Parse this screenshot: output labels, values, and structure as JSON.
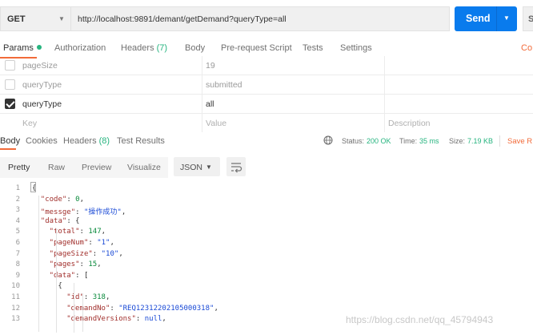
{
  "request": {
    "method": "GET",
    "url": "http://localhost:9891/demant/getDemand?queryType=all",
    "send_label": "Send",
    "save_label_partial": "S"
  },
  "request_tabs": {
    "params": "Params",
    "authorization": "Authorization",
    "headers": "Headers",
    "headers_count": "(7)",
    "body": "Body",
    "prerequest": "Pre-request Script",
    "tests": "Tests",
    "settings": "Settings",
    "cookies_partial": "Co"
  },
  "params": {
    "rows": [
      {
        "key": "pageSize",
        "value": "19",
        "checked": false
      },
      {
        "key": "queryType",
        "value": "submitted",
        "checked": false
      },
      {
        "key": "queryType",
        "value": "all",
        "checked": true
      }
    ],
    "placeholder": {
      "key": "Key",
      "value": "Value",
      "description": "Description"
    }
  },
  "response_tabs": {
    "body": "Body",
    "cookies": "Cookies",
    "headers": "Headers",
    "headers_count": "(8)",
    "test_results": "Test Results"
  },
  "response_status": {
    "status_label": "Status:",
    "status_value": "200 OK",
    "time_label": "Time:",
    "time_value": "35 ms",
    "size_label": "Size:",
    "size_value": "7.19 KB",
    "save_partial": "Save R"
  },
  "format_toolbar": {
    "options": [
      "Pretty",
      "Raw",
      "Preview",
      "Visualize"
    ],
    "active": "Pretty",
    "format": "JSON"
  },
  "code_lines": [
    {
      "n": "1",
      "text": "{"
    },
    {
      "n": "2",
      "key": "\"code\"",
      "val": "0",
      "vtype": "n",
      "trail": ","
    },
    {
      "n": "3",
      "key": "\"messge\"",
      "val": "\"操作成功\"",
      "vtype": "s",
      "trail": ","
    },
    {
      "n": "4",
      "key": "\"data\"",
      "val": "{",
      "vtype": "p",
      "trail": ""
    },
    {
      "n": "5",
      "key": "\"total\"",
      "val": "147",
      "vtype": "n",
      "trail": ","
    },
    {
      "n": "6",
      "key": "\"pageNum\"",
      "val": "\"1\"",
      "vtype": "s",
      "trail": ","
    },
    {
      "n": "7",
      "key": "\"pageSize\"",
      "val": "\"10\"",
      "vtype": "s",
      "trail": ","
    },
    {
      "n": "8",
      "key": "\"pages\"",
      "val": "15",
      "vtype": "n",
      "trail": ","
    },
    {
      "n": "9",
      "key": "\"data\"",
      "val": "[",
      "vtype": "p",
      "trail": ""
    },
    {
      "n": "10",
      "text": "{"
    },
    {
      "n": "11",
      "key": "\"id\"",
      "val": "318",
      "vtype": "n",
      "trail": ","
    },
    {
      "n": "12",
      "key": "\"demandNo\"",
      "val": "\"REQ12312202105000318\"",
      "vtype": "s",
      "trail": ","
    },
    {
      "n": "13",
      "key": "\"demandVersions\"",
      "val": "null",
      "vtype": "nl",
      "trail": ","
    }
  ],
  "watermark": "https://blog.csdn.net/qq_45794943"
}
